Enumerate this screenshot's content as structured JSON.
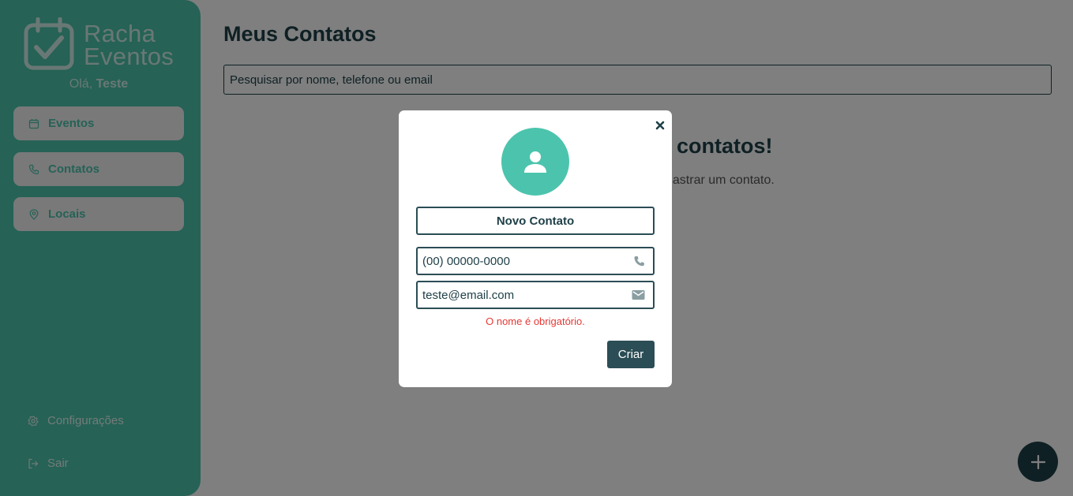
{
  "sidebar": {
    "logo_line1": "Racha",
    "logo_line2": "Eventos",
    "greeting_prefix": "Olá,",
    "user_name": "Teste",
    "nav": [
      {
        "label": "Eventos",
        "icon": "calendar-icon"
      },
      {
        "label": "Contatos",
        "icon": "phone-icon"
      },
      {
        "label": "Locais",
        "icon": "location-pin-icon"
      }
    ],
    "settings_label": "Configurações",
    "logout_label": "Sair"
  },
  "main": {
    "title": "Meus Contatos",
    "search_placeholder": "Pesquisar por nome, telefone ou email",
    "empty_title_visible": "contatos!",
    "empty_subtitle_visible": "dastrar um contato."
  },
  "modal": {
    "name_placeholder": "Novo Contato",
    "phone_placeholder": "(00) 00000-0000",
    "email_value": "teste@email.com",
    "error_message": "O nome é obrigatório.",
    "submit_label": "Criar"
  },
  "colors": {
    "sidebar": "#4cc4ad",
    "primary_dark": "#1f4048",
    "error": "#e53935",
    "overlay": "rgba(0,0,0,0.5)"
  }
}
